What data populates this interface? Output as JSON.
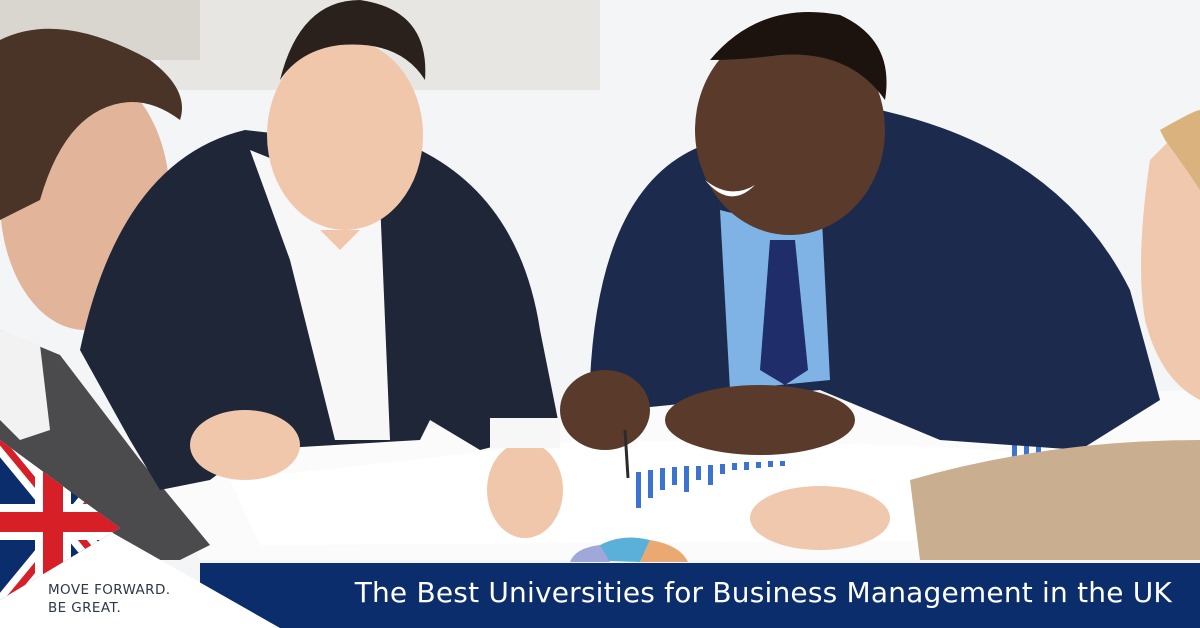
{
  "banner": {
    "headline": "The Best Universities for Business Management in the UK"
  },
  "tagline": {
    "line1": "MOVE FORWARD.",
    "line2": "BE GREAT."
  },
  "colors": {
    "banner_bg": "#0b2d6b",
    "flag_red": "#d61f26",
    "flag_blue": "#0b2d6b",
    "tagline_text": "#2d3748"
  },
  "icons": {
    "flag": "union-jack-flag-icon"
  }
}
